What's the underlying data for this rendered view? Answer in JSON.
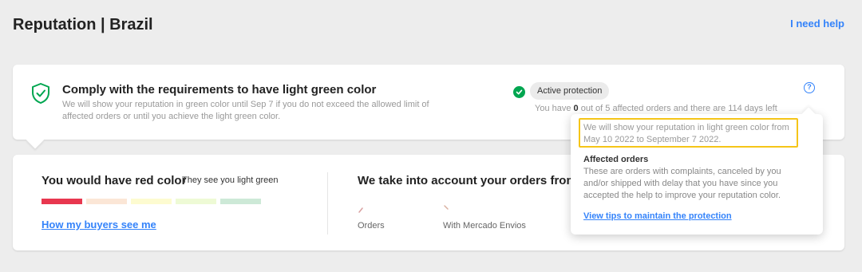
{
  "header": {
    "title": "Reputation | Brazil",
    "help_link": "I need help"
  },
  "comply_card": {
    "icon": "shield-check-icon",
    "title": "Comply with the requirements to have light green color",
    "description": "We will show your reputation in green color until Sep 7 if you do not exceed the allowed limit of affected orders or until you achieve the light green color.",
    "protection_badge": "Active protection",
    "orders_prefix": "You have ",
    "orders_count": "0",
    "orders_suffix": " out of 5 affected orders and there are 114 days left",
    "help_icon": "?"
  },
  "reputation_card": {
    "title": "You would have red color",
    "subtitle": "They see you light green",
    "thermometer_colors": [
      "#e8374f",
      "#fbe6d6",
      "#fdfbd0",
      "#eefad5",
      "#cde9d7"
    ],
    "buyers_link": "How my buyers see me",
    "orders_title": "We take into account your orders from th",
    "stats": [
      {
        "label": "Orders"
      },
      {
        "label": "With Mercado Envios"
      }
    ]
  },
  "popover": {
    "highlight_text": "We will show your reputation in light green color from May 10 2022 to September 7 2022.",
    "heading": "Affected orders",
    "description": "These are orders with complaints, canceled by you and/or shipped with delay that you have since you accepted the help to improve your reputation color.",
    "link": "View tips to maintain the protection"
  },
  "colors": {
    "accent_blue": "#3483fa",
    "success_green": "#00a650",
    "highlight_yellow": "#f5c518"
  }
}
